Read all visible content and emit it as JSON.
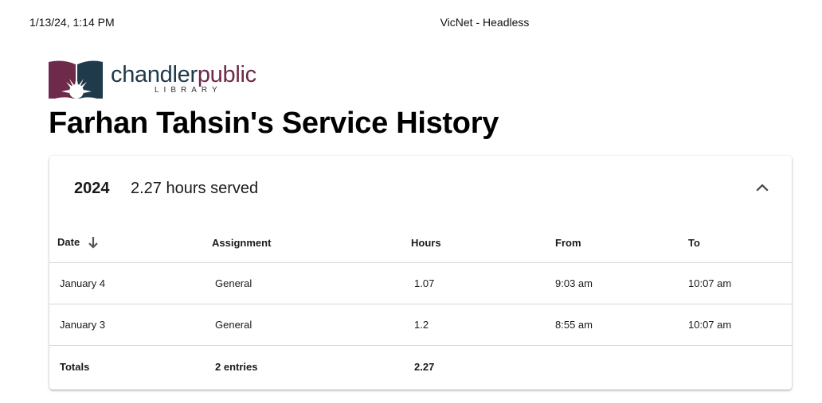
{
  "print_header": {
    "datetime": "1/13/24, 1:14 PM",
    "window_title": "VicNet - Headless"
  },
  "logo": {
    "word_part1": "chandler",
    "word_part2": "public",
    "subtitle": "LIBRARY",
    "colors": {
      "navy": "#1f3a4a",
      "plum": "#6e2a4a"
    }
  },
  "page_title": "Farhan Tahsin's Service History",
  "panel": {
    "year": "2024",
    "hours_served": "2.27 hours served",
    "expanded": true,
    "table": {
      "headers": {
        "date": "Date",
        "assignment": "Assignment",
        "hours": "Hours",
        "from": "From",
        "to": "To"
      },
      "sort": {
        "column": "date",
        "direction": "descending",
        "icon": "arrow-down-icon"
      },
      "rows": [
        {
          "date": "January 4",
          "assignment": "General",
          "hours": "1.07",
          "from": "9:03 am",
          "to": "10:07 am"
        },
        {
          "date": "January 3",
          "assignment": "General",
          "hours": "1.2",
          "from": "8:55 am",
          "to": "10:07 am"
        }
      ],
      "totals": {
        "label": "Totals",
        "entries": "2 entries",
        "hours": "2.27"
      }
    }
  }
}
